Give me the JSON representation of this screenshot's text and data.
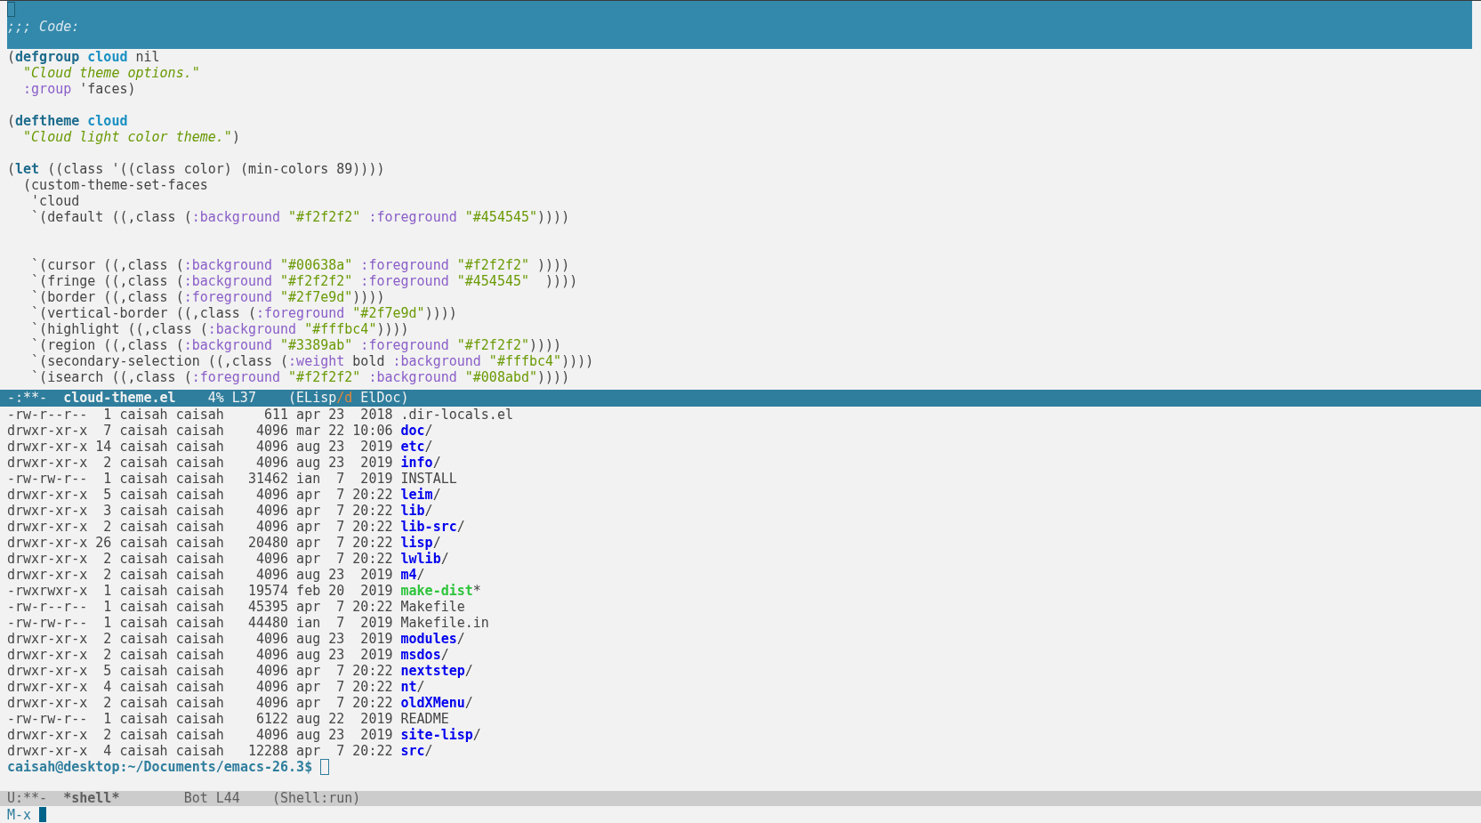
{
  "code_buffer": {
    "header": {
      "comment": ";;; Code:"
    },
    "lines": [
      {
        "kind": "code",
        "segments": [
          {
            "text": "(",
            "kind": "plain"
          },
          {
            "text": "defgroup",
            "kind": "keyword"
          },
          {
            "text": " cloud",
            "kind": "name"
          },
          {
            "text": " nil",
            "kind": "plain"
          }
        ]
      },
      {
        "kind": "code",
        "segments": [
          {
            "text": "  \"Cloud theme options.\"",
            "kind": "doc"
          }
        ]
      },
      {
        "kind": "code",
        "segments": [
          {
            "text": "  :group",
            "kind": "constant"
          },
          {
            "text": " 'faces)",
            "kind": "plain"
          }
        ]
      },
      {
        "kind": "blank"
      },
      {
        "kind": "code",
        "segments": [
          {
            "text": "(",
            "kind": "plain"
          },
          {
            "text": "deftheme",
            "kind": "keyword"
          },
          {
            "text": " cloud",
            "kind": "name"
          }
        ]
      },
      {
        "kind": "code",
        "segments": [
          {
            "text": "  \"Cloud light color theme.\"",
            "kind": "doc"
          },
          {
            "text": ")",
            "kind": "plain"
          }
        ]
      },
      {
        "kind": "blank"
      },
      {
        "kind": "code",
        "segments": [
          {
            "text": "(",
            "kind": "plain"
          },
          {
            "text": "let",
            "kind": "keyword"
          },
          {
            "text": " ((class '((class color) (min-colors 89))))",
            "kind": "plain"
          }
        ]
      },
      {
        "kind": "code",
        "segments": [
          {
            "text": "  (custom-theme-set-faces",
            "kind": "plain"
          }
        ]
      },
      {
        "kind": "code",
        "segments": [
          {
            "text": "   'cloud",
            "kind": "plain"
          }
        ]
      },
      {
        "kind": "code",
        "segments": [
          {
            "text": "   `(default ((,class (",
            "kind": "plain"
          },
          {
            "text": ":background",
            "kind": "constant"
          },
          {
            "text": " \"#f2f2f2\"",
            "kind": "string"
          },
          {
            "text": " :foreground",
            "kind": "constant"
          },
          {
            "text": " \"#454545\"",
            "kind": "string"
          },
          {
            "text": "))))",
            "kind": "plain"
          }
        ]
      },
      {
        "kind": "blank"
      },
      {
        "kind": "blank"
      },
      {
        "kind": "code",
        "segments": [
          {
            "text": "   `(cursor ((,class (",
            "kind": "plain"
          },
          {
            "text": ":background",
            "kind": "constant"
          },
          {
            "text": " \"#00638a\"",
            "kind": "string"
          },
          {
            "text": " :foreground",
            "kind": "constant"
          },
          {
            "text": " \"#f2f2f2\"",
            "kind": "string"
          },
          {
            "text": " ))))",
            "kind": "plain"
          }
        ]
      },
      {
        "kind": "code",
        "segments": [
          {
            "text": "   `(fringe ((,class (",
            "kind": "plain"
          },
          {
            "text": ":background",
            "kind": "constant"
          },
          {
            "text": " \"#f2f2f2\"",
            "kind": "string"
          },
          {
            "text": " :foreground",
            "kind": "constant"
          },
          {
            "text": " \"#454545\"",
            "kind": "string"
          },
          {
            "text": "  ))))",
            "kind": "plain"
          }
        ]
      },
      {
        "kind": "code",
        "segments": [
          {
            "text": "   `(border ((,class (",
            "kind": "plain"
          },
          {
            "text": ":foreground",
            "kind": "constant"
          },
          {
            "text": " \"#2f7e9d\"",
            "kind": "string"
          },
          {
            "text": "))))",
            "kind": "plain"
          }
        ]
      },
      {
        "kind": "code",
        "segments": [
          {
            "text": "   `(vertical-border ((,class (",
            "kind": "plain"
          },
          {
            "text": ":foreground",
            "kind": "constant"
          },
          {
            "text": " \"#2f7e9d\"",
            "kind": "string"
          },
          {
            "text": "))))",
            "kind": "plain"
          }
        ]
      },
      {
        "kind": "code",
        "segments": [
          {
            "text": "   `(highlight ((,class (",
            "kind": "plain"
          },
          {
            "text": ":background",
            "kind": "constant"
          },
          {
            "text": " \"#fffbc4\"",
            "kind": "string"
          },
          {
            "text": "))))",
            "kind": "plain"
          }
        ]
      },
      {
        "kind": "code",
        "segments": [
          {
            "text": "   `(region ((,class (",
            "kind": "plain"
          },
          {
            "text": ":background",
            "kind": "constant"
          },
          {
            "text": " \"#3389ab\"",
            "kind": "string"
          },
          {
            "text": " :foreground",
            "kind": "constant"
          },
          {
            "text": " \"#f2f2f2\"",
            "kind": "string"
          },
          {
            "text": "))))",
            "kind": "plain"
          }
        ]
      },
      {
        "kind": "code",
        "segments": [
          {
            "text": "   `(secondary-selection ((,class (",
            "kind": "plain"
          },
          {
            "text": ":weight",
            "kind": "constant"
          },
          {
            "text": " bold",
            "kind": "plain"
          },
          {
            "text": " :background",
            "kind": "constant"
          },
          {
            "text": " \"#fffbc4\"",
            "kind": "string"
          },
          {
            "text": "))))",
            "kind": "plain"
          }
        ]
      },
      {
        "kind": "code",
        "segments": [
          {
            "text": "   `(isearch ((,class (",
            "kind": "plain"
          },
          {
            "text": ":foreground",
            "kind": "constant"
          },
          {
            "text": " \"#f2f2f2\"",
            "kind": "string"
          },
          {
            "text": " :background",
            "kind": "constant"
          },
          {
            "text": " \"#008abd\"",
            "kind": "string"
          },
          {
            "text": "))))",
            "kind": "plain"
          }
        ]
      }
    ]
  },
  "code_mode_line": {
    "active": true,
    "status": "-:**-",
    "buffer": "cloud-theme.el",
    "position": "4% L37",
    "modes": [
      {
        "text": "(ELisp",
        "kind": "plain"
      },
      {
        "text": "/d",
        "kind": "accent"
      },
      {
        "text": " ElDoc)",
        "kind": "plain"
      }
    ]
  },
  "shell_buffer": {
    "entries": [
      {
        "info": "-rw-r--r--  1 caisah caisah     611 apr 23  2018",
        "name": ".dir-locals.el",
        "kind": "file"
      },
      {
        "info": "drwxr-xr-x  7 caisah caisah    4096 mar 22 10:06",
        "name": "doc",
        "suffix": "/",
        "kind": "dir"
      },
      {
        "info": "drwxr-xr-x 14 caisah caisah    4096 aug 23  2019",
        "name": "etc",
        "suffix": "/",
        "kind": "dir"
      },
      {
        "info": "drwxr-xr-x  2 caisah caisah    4096 aug 23  2019",
        "name": "info",
        "suffix": "/",
        "kind": "dir"
      },
      {
        "info": "-rw-rw-r--  1 caisah caisah   31462 ian  7  2019",
        "name": "INSTALL",
        "kind": "file"
      },
      {
        "info": "drwxr-xr-x  5 caisah caisah    4096 apr  7 20:22",
        "name": "leim",
        "suffix": "/",
        "kind": "dir"
      },
      {
        "info": "drwxr-xr-x  3 caisah caisah    4096 apr  7 20:22",
        "name": "lib",
        "suffix": "/",
        "kind": "dir"
      },
      {
        "info": "drwxr-xr-x  2 caisah caisah    4096 apr  7 20:22",
        "name": "lib-src",
        "suffix": "/",
        "kind": "dir"
      },
      {
        "info": "drwxr-xr-x 26 caisah caisah   20480 apr  7 20:22",
        "name": "lisp",
        "suffix": "/",
        "kind": "dir"
      },
      {
        "info": "drwxr-xr-x  2 caisah caisah    4096 apr  7 20:22",
        "name": "lwlib",
        "suffix": "/",
        "kind": "dir"
      },
      {
        "info": "drwxr-xr-x  2 caisah caisah    4096 aug 23  2019",
        "name": "m4",
        "suffix": "/",
        "kind": "dir"
      },
      {
        "info": "-rwxrwxr-x  1 caisah caisah   19574 feb 20  2019",
        "name": "make-dist",
        "suffix": "*",
        "kind": "exec"
      },
      {
        "info": "-rw-r--r--  1 caisah caisah   45395 apr  7 20:22",
        "name": "Makefile",
        "kind": "file"
      },
      {
        "info": "-rw-rw-r--  1 caisah caisah   44480 ian  7  2019",
        "name": "Makefile.in",
        "kind": "file"
      },
      {
        "info": "drwxr-xr-x  2 caisah caisah    4096 aug 23  2019",
        "name": "modules",
        "suffix": "/",
        "kind": "dir"
      },
      {
        "info": "drwxr-xr-x  2 caisah caisah    4096 aug 23  2019",
        "name": "msdos",
        "suffix": "/",
        "kind": "dir"
      },
      {
        "info": "drwxr-xr-x  5 caisah caisah    4096 apr  7 20:22",
        "name": "nextstep",
        "suffix": "/",
        "kind": "dir"
      },
      {
        "info": "drwxr-xr-x  4 caisah caisah    4096 apr  7 20:22",
        "name": "nt",
        "suffix": "/",
        "kind": "dir"
      },
      {
        "info": "drwxr-xr-x  2 caisah caisah    4096 apr  7 20:22",
        "name": "oldXMenu",
        "suffix": "/",
        "kind": "dir"
      },
      {
        "info": "-rw-rw-r--  1 caisah caisah    6122 aug 22  2019",
        "name": "README",
        "kind": "file"
      },
      {
        "info": "drwxr-xr-x  2 caisah caisah    4096 aug 23  2019",
        "name": "site-lisp",
        "suffix": "/",
        "kind": "dir"
      },
      {
        "info": "drwxr-xr-x  4 caisah caisah   12288 apr  7 20:22",
        "name": "src",
        "suffix": "/",
        "kind": "dir"
      }
    ],
    "prompt": "caisah@desktop:~/Documents/emacs-26.3$"
  },
  "shell_mode_line": {
    "active": false,
    "status": "U:**-",
    "buffer": "*shell*",
    "position": "Bot L44",
    "modes": [
      {
        "text": "(Shell:run)",
        "kind": "plain"
      }
    ]
  },
  "minibuffer": {
    "prompt": "M-x"
  }
}
